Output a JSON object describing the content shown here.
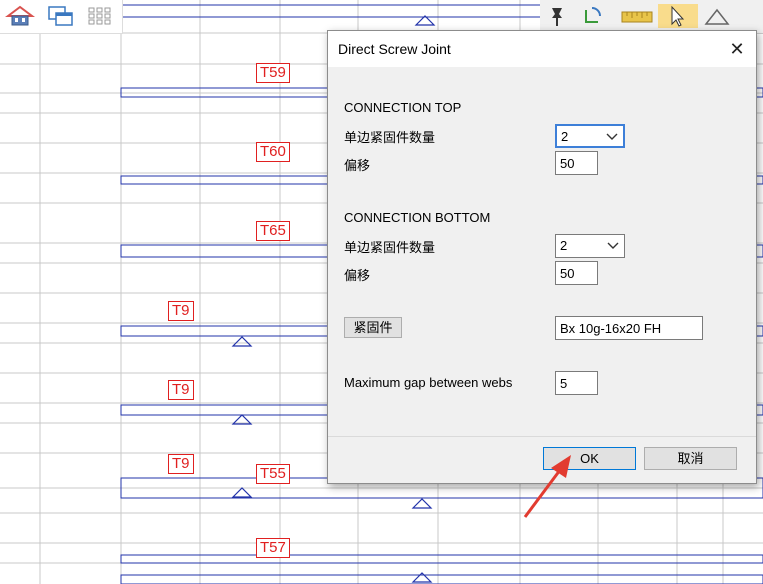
{
  "tags": [
    {
      "text": "T59"
    },
    {
      "text": "T60"
    },
    {
      "text": "T65"
    },
    {
      "text": "T9"
    },
    {
      "text": "T9"
    },
    {
      "text": "T9"
    },
    {
      "text": "T55"
    },
    {
      "text": "T57"
    }
  ],
  "toolbar": {
    "icons": [
      "home-icon",
      "windows-icon",
      "grid-icon",
      "pin-icon",
      "rotate-icon",
      "ruler-icon",
      "pointer-icon",
      "shape-icon"
    ]
  },
  "dialog": {
    "title": "Direct Screw Joint",
    "close_label": "✕",
    "connection_top": {
      "heading": "CONNECTION TOP",
      "fastener_count_label": "单边紧固件数量",
      "fastener_count_value": "2",
      "offset_label": "偏移",
      "offset_value": "50"
    },
    "connection_bottom": {
      "heading": "CONNECTION BOTTOM",
      "fastener_count_label": "单边紧固件数量",
      "fastener_count_value": "2",
      "offset_label": "偏移",
      "offset_value": "50"
    },
    "fastener": {
      "button_label": "紧固件",
      "value": "Bx 10g-16x20 FH"
    },
    "max_gap": {
      "label": "Maximum gap between webs",
      "value": "5"
    },
    "ok_label": "OK",
    "cancel_label": "取消"
  },
  "colors": {
    "grid": "#c8c8c8",
    "blue_line": "#2233aa",
    "tag_red": "#e02020",
    "dialog_bg": "#f0f0f0",
    "arrow": "#e23b30"
  }
}
